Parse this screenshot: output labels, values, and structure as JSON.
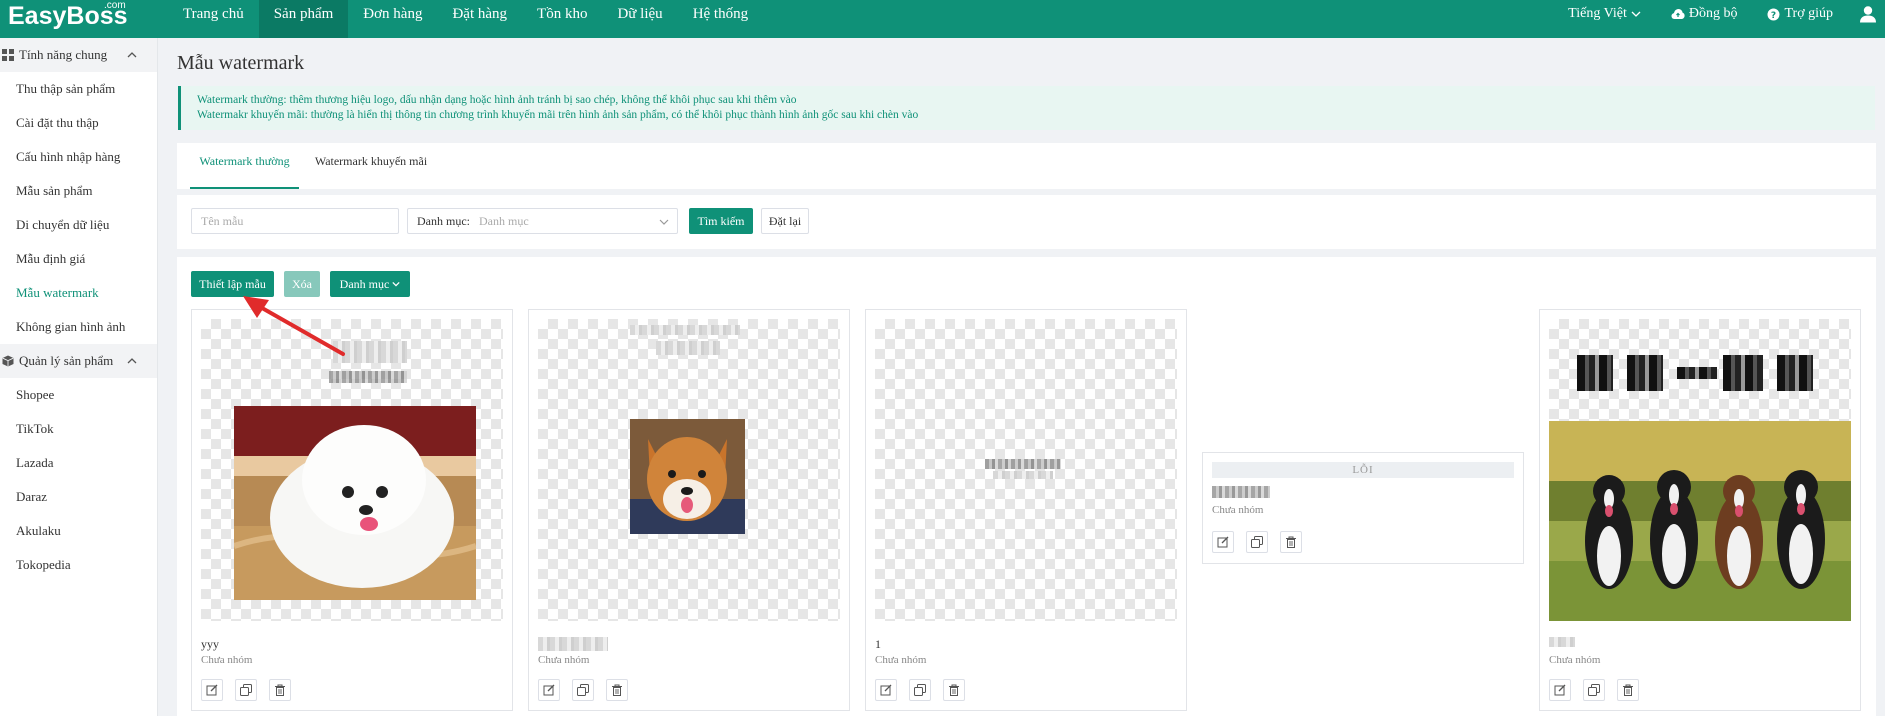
{
  "app": {
    "logo": "EasyBoss",
    "logo_sup": ".com"
  },
  "nav": {
    "items": [
      {
        "label": "Trang chủ"
      },
      {
        "label": "Sản phẩm"
      },
      {
        "label": "Đơn hàng"
      },
      {
        "label": "Đặt hàng"
      },
      {
        "label": "Tồn kho"
      },
      {
        "label": "Dữ liệu"
      },
      {
        "label": "Hệ thống"
      }
    ],
    "active_index": 1,
    "language": "Tiếng Việt",
    "sync": "Đồng bộ",
    "help": "Trợ giúp"
  },
  "sidebar": {
    "groups": [
      {
        "label": "Tính năng chung",
        "items": [
          {
            "label": "Thu thập sản phẩm"
          },
          {
            "label": "Cài đặt thu thập"
          },
          {
            "label": "Cấu hình nhập hàng"
          },
          {
            "label": "Mẫu sản phẩm"
          },
          {
            "label": "Di chuyển dữ liệu"
          },
          {
            "label": "Mẫu định giá"
          },
          {
            "label": "Mẫu watermark"
          },
          {
            "label": "Không gian hình ảnh"
          }
        ]
      },
      {
        "label": "Quản lý sản phẩm",
        "items": [
          {
            "label": "Shopee"
          },
          {
            "label": "TikTok"
          },
          {
            "label": "Lazada"
          },
          {
            "label": "Daraz"
          },
          {
            "label": "Akulaku"
          },
          {
            "label": "Tokopedia"
          }
        ]
      }
    ],
    "active_item": "Mẫu watermark"
  },
  "page": {
    "title": "Mẫu watermark",
    "notice_line1": "Watermark thường: thêm thương hiệu logo, dấu nhận dạng hoặc hình ảnh tránh bị sao chép, không thể khôi phục sau khi thêm vào",
    "notice_line2": "Watermakr khuyến mãi: thường là hiển thị thông tin chương trình khuyến mãi trên hình ảnh sản phẩm, có thể khôi phục thành hình ảnh gốc sau khi chèn vào"
  },
  "tabs": [
    {
      "label": "Watermark thường",
      "active": true
    },
    {
      "label": "Watermark khuyến mãi",
      "active": false
    }
  ],
  "filters": {
    "name_placeholder": "Tên mẫu",
    "category_label": "Danh mục:",
    "category_placeholder": "Danh mục",
    "search_label": "Tìm kiếm",
    "reset_label": "Đặt lại"
  },
  "toolbar": {
    "setup_label": "Thiết lập mẫu",
    "delete_label": "Xóa",
    "category_label": "Danh mục"
  },
  "cards": [
    {
      "name": "yyy",
      "group": "Chưa nhóm",
      "preview": "white-pomeranian-puppy"
    },
    {
      "name": "",
      "group": "Chưa nhóm",
      "preview": "shiba-inu-face"
    },
    {
      "name": "1",
      "group": "Chưa nhóm",
      "preview": "text-watermark-only"
    },
    {
      "name": "",
      "group": "Chưa nhóm",
      "error": "LỖI"
    },
    {
      "name": "",
      "group": "Chưa nhóm",
      "preview": "four-border-collies"
    }
  ],
  "colors": {
    "primary": "#0f9178",
    "nav_active": "#0b7a64",
    "notice_bg": "#e8f6f2",
    "arrow": "#e02b2b"
  }
}
